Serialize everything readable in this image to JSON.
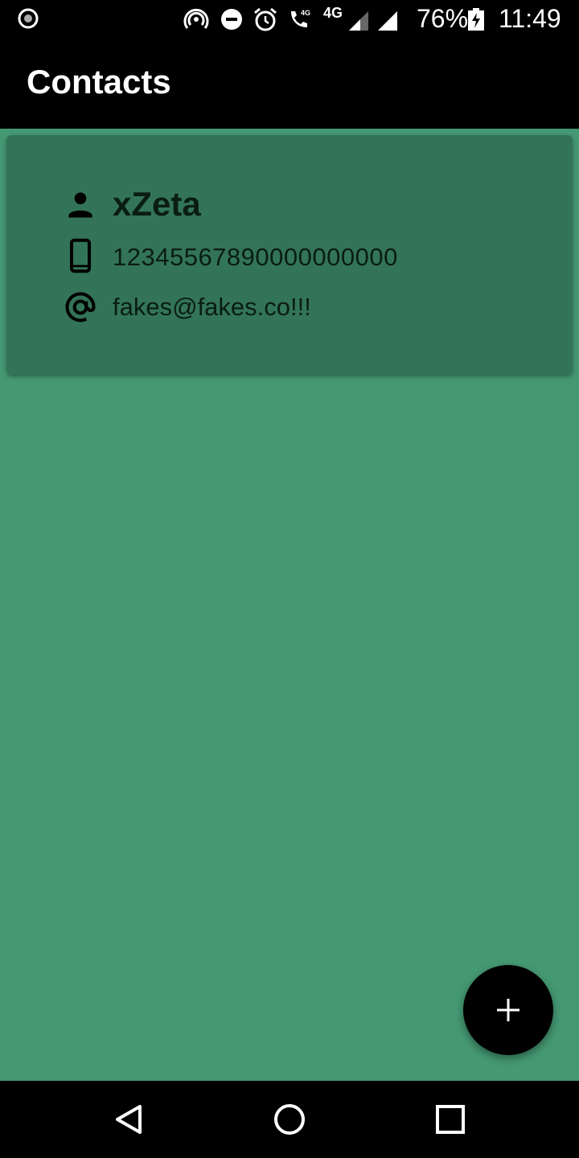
{
  "status_bar": {
    "network": "4G",
    "call_badge": "4G",
    "battery_percent": "76%",
    "time": "11:49",
    "icons": [
      "screen-record-icon",
      "hotspot-icon",
      "do-not-disturb-icon",
      "alarm-icon",
      "wifi-call-icon",
      "signal-icon",
      "signal-icon",
      "battery-charging-icon"
    ]
  },
  "app_bar": {
    "title": "Contacts"
  },
  "contact": {
    "name": "xZeta",
    "phone": "12345567890000000000",
    "email": "fakes@fakes.co!!!",
    "icons": [
      "person-icon",
      "phone-icon",
      "at-icon"
    ]
  },
  "fab": {
    "icon": "add-icon"
  },
  "nav_bar": {
    "icons": [
      "back-icon",
      "home-icon",
      "recents-icon"
    ]
  },
  "colors": {
    "background": "#449872",
    "card": "#337458",
    "bars": "#000000",
    "text_dark": "#0a1d13"
  }
}
